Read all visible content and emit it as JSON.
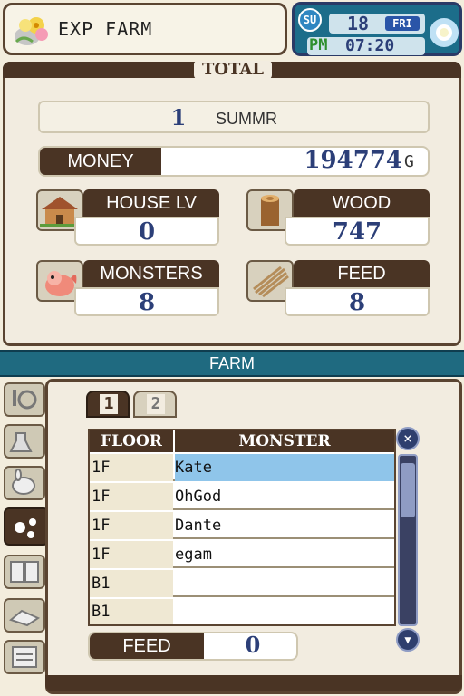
{
  "header": {
    "title": "EXP FARM",
    "season_icon": "season-su-icon",
    "date_day": "18",
    "day_of_week": "FRI",
    "period": "PM",
    "time": "07:20"
  },
  "total": {
    "heading": "TOTAL",
    "day": "1",
    "season": "SUMMR",
    "money_label": "MONEY",
    "money_value": "194774",
    "money_unit": "G",
    "stats": [
      {
        "label": "HOUSE LV",
        "value": "0",
        "icon": "house-icon"
      },
      {
        "label": "WOOD",
        "value": "747",
        "icon": "wood-log-icon"
      },
      {
        "label": "MONSTERS",
        "value": "8",
        "icon": "monster-icon"
      },
      {
        "label": "FEED",
        "value": "8",
        "icon": "feed-icon"
      }
    ]
  },
  "farm": {
    "heading": "FARM",
    "tabs": [
      "1",
      "2"
    ],
    "columns": [
      "FLOOR",
      "MONSTER"
    ],
    "rows": [
      {
        "floor": "1F",
        "monster": "Kate"
      },
      {
        "floor": "1F",
        "monster": "OhGod"
      },
      {
        "floor": "1F",
        "monster": "Dante"
      },
      {
        "floor": "1F",
        "monster": "egam"
      },
      {
        "floor": "B1",
        "monster": ""
      },
      {
        "floor": "B1",
        "monster": ""
      }
    ],
    "feed_label": "FEED",
    "feed_value": "0"
  },
  "colors": {
    "brown": "#4a3424",
    "cream": "#f2ece0",
    "value_blue": "#2c3f78",
    "teal": "#1f6a80",
    "selected_row": "#8fc5ea"
  }
}
